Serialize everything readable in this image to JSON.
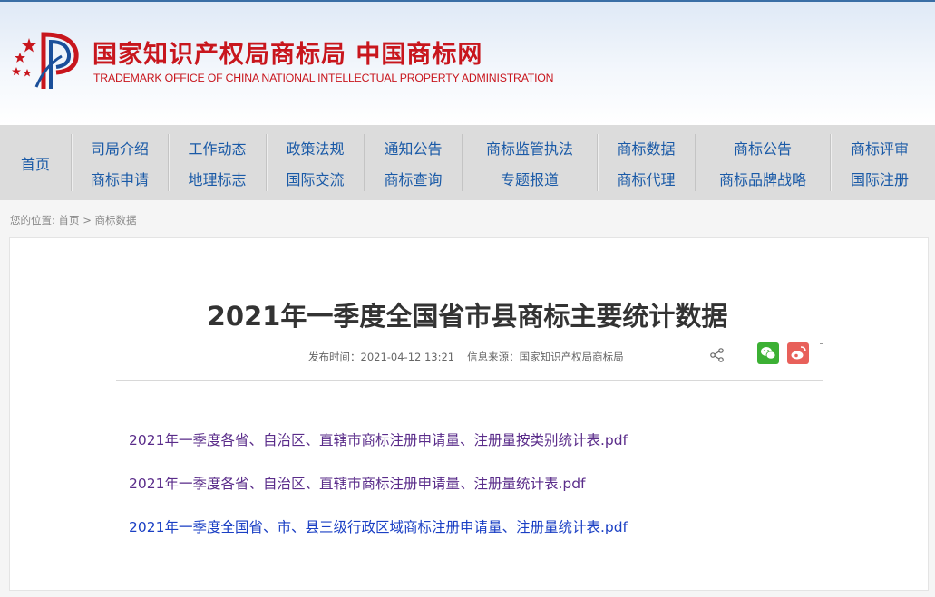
{
  "header": {
    "brand_cn": "国家知识产权局商标局 中国商标网",
    "brand_en": "TRADEMARK OFFICE OF CHINA NATIONAL INTELLECTUAL PROPERTY ADMINISTRATION",
    "logo_icon": "cnipa-logo"
  },
  "nav": {
    "home": "首页",
    "columns": [
      [
        "司局介绍",
        "商标申请"
      ],
      [
        "工作动态",
        "地理标志"
      ],
      [
        "政策法规",
        "国际交流"
      ],
      [
        "通知公告",
        "商标查询"
      ],
      [
        "商标监管执法",
        "专题报道"
      ],
      [
        "商标数据",
        "商标代理"
      ],
      [
        "商标公告",
        "商标品牌战略"
      ],
      [
        "商标评审",
        "国际注册"
      ]
    ]
  },
  "breadcrumb": {
    "prefix": "您的位置:",
    "home": "首页",
    "separator": ">",
    "current": "商标数据"
  },
  "article": {
    "title": "2021年一季度全国省市县商标主要统计数据",
    "publish_time": "发布时间：2021-04-12 13:21",
    "source": "信息来源：国家知识产权局商标局",
    "share_icon": "share-icon",
    "links": [
      "2021年一季度各省、自治区、直辖市商标注册申请量、注册量按类别统计表.pdf",
      "2021年一季度各省、自治区、直辖市商标注册申请量、注册量统计表.pdf",
      "2021年一季度全国省、市、县三级行政区域商标注册申请量、注册量统计表.pdf"
    ]
  },
  "colors": {
    "brand_red": "#c8161d",
    "nav_blue": "#1a5aa7",
    "visited_link": "#5a2c8a",
    "link_blue": "#1a3fc4",
    "wechat_green": "#3cb034",
    "weibo_red": "#e8605a"
  }
}
